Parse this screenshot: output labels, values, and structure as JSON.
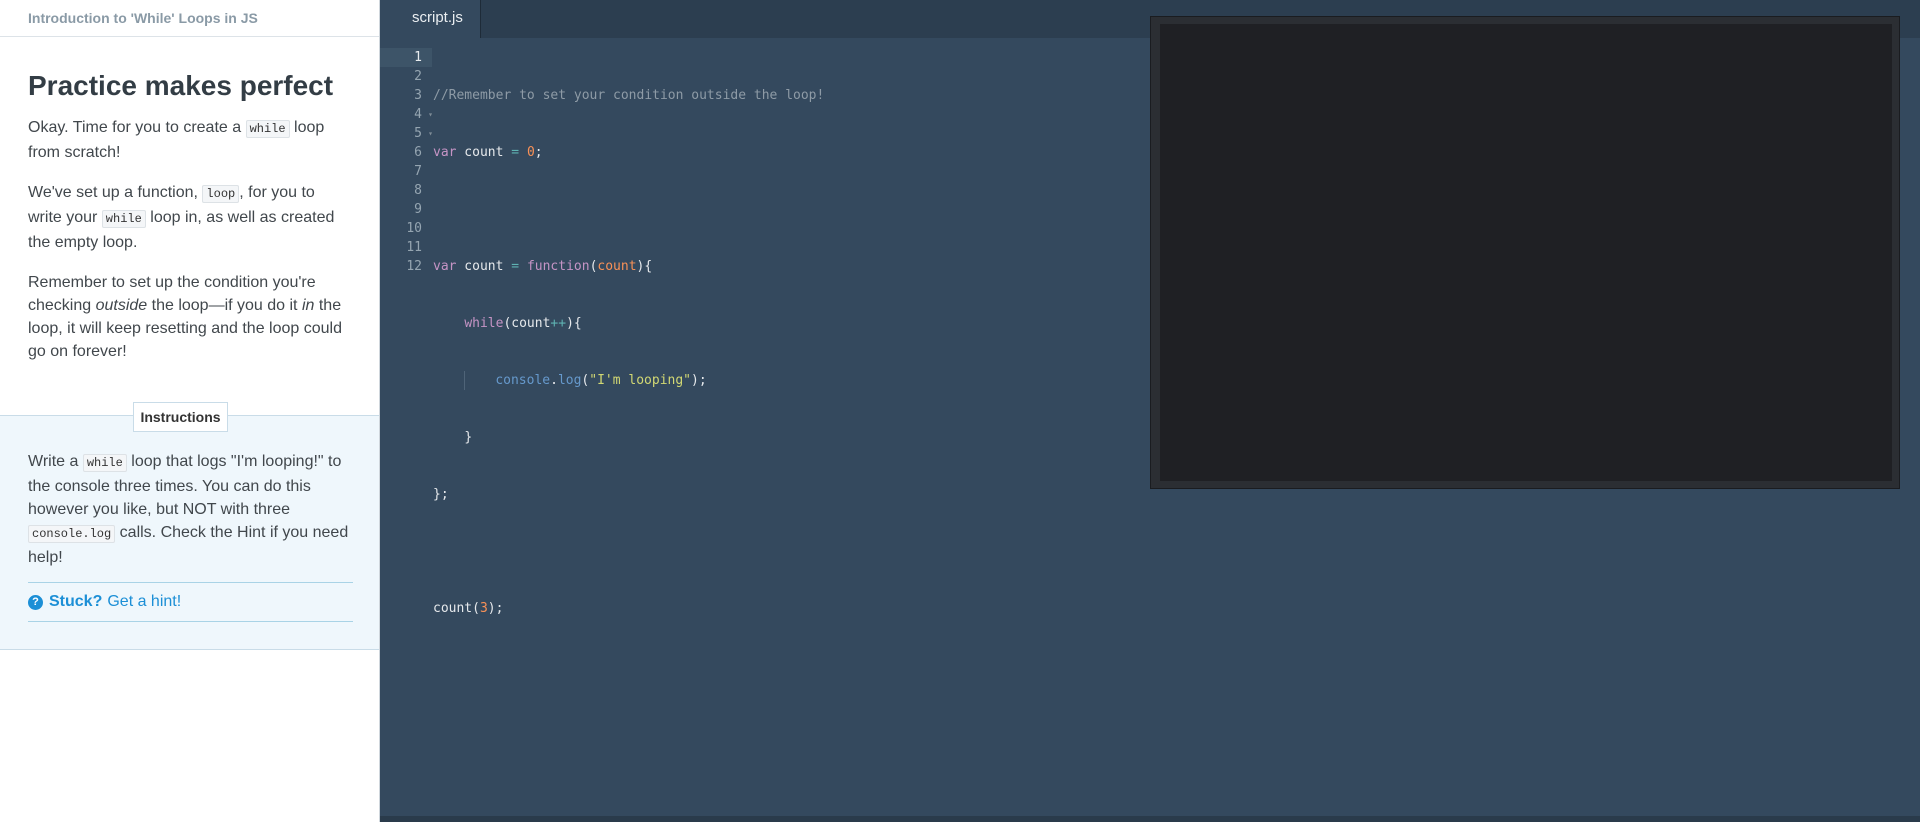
{
  "course": {
    "title": "Introduction to 'While' Loops in JS"
  },
  "lesson": {
    "heading": "Practice makes perfect",
    "p1": {
      "a": "Okay. Time for you to create a ",
      "code": "while",
      "b": " loop from scratch!"
    },
    "p2": {
      "a": "We've set up a function, ",
      "code1": "loop",
      "b": ", for you to write your ",
      "code2": "while",
      "c": " loop in, as well as created the empty loop."
    },
    "p3": {
      "a": "Remember to set up the condition you're checking ",
      "em1": "outside",
      "b": " the loop—if you do it ",
      "em2": "in",
      "c": " the loop, it will keep resetting and the loop could go on forever!"
    }
  },
  "instructions": {
    "tab_label": "Instructions",
    "text": {
      "a": "Write a ",
      "code1": "while",
      "b": " loop that logs \"I'm looping!\" to the console three times. You can do this however you like, but NOT with three ",
      "code2": "console.log",
      "c": " calls. Check the Hint if you need help!"
    },
    "hint": {
      "icon": "?",
      "stuck": "Stuck?",
      "link": "Get a hint!"
    }
  },
  "editor": {
    "tab": "script.js",
    "line_numbers": [
      "1",
      "2",
      "3",
      "4",
      "5",
      "6",
      "7",
      "8",
      "9",
      "10",
      "11",
      "12"
    ],
    "code": {
      "l1": {
        "comment": "//Remember to set your condition outside the loop!"
      },
      "l2": {
        "kw": "var",
        "a": " count ",
        "op": "=",
        "sp": " ",
        "num": "0",
        "end": ";"
      },
      "l4": {
        "kw": "var",
        "a": " count ",
        "op": "=",
        "sp": " ",
        "kw2": "function",
        "p1": "(",
        "param": "count",
        "p2": "){"
      },
      "l5": {
        "kw": "while",
        "a": "(count",
        "op": "++",
        "b": "){"
      },
      "l6": {
        "obj": "console",
        "dot": ".",
        "fn": "log",
        "p1": "(",
        "str": "\"I'm looping\"",
        "p2": ");"
      },
      "l7": {
        "t": "}"
      },
      "l8": {
        "t": "};"
      },
      "l10": {
        "a": "count(",
        "num": "3",
        "b": ");"
      }
    }
  }
}
